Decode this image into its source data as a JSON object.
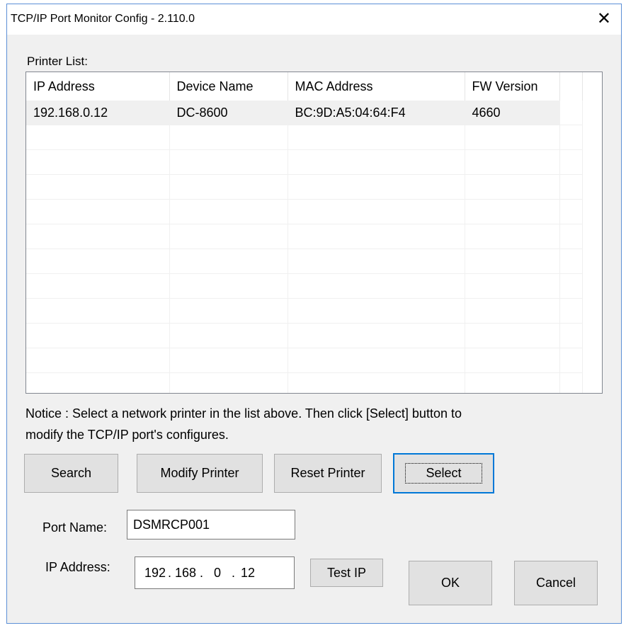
{
  "window": {
    "title": "TCP/IP Port Monitor Config - 2.110.0",
    "close_glyph": "✕"
  },
  "printer_list": {
    "label": "Printer List:",
    "columns": [
      "IP Address",
      "Device Name",
      "MAC Address",
      "FW Version"
    ],
    "rows": [
      [
        "192.168.0.12",
        "DC-8600",
        "BC:9D:A5:04:64:F4",
        "4660"
      ]
    ]
  },
  "notice": {
    "line1": "Notice : Select a network printer in the list above. Then click [Select] button to",
    "line2": "modify the TCP/IP port's configures."
  },
  "buttons": {
    "search": "Search",
    "modify_printer": "Modify Printer",
    "reset_printer": "Reset Printer",
    "select": "Select",
    "test_ip": "Test IP",
    "ok": "OK",
    "cancel": "Cancel"
  },
  "port_name": {
    "label": "Port Name:",
    "value": "DSMRCP001"
  },
  "ip_address": {
    "label": "IP Address:",
    "octets": [
      "192",
      "168",
      "0",
      "12"
    ]
  }
}
